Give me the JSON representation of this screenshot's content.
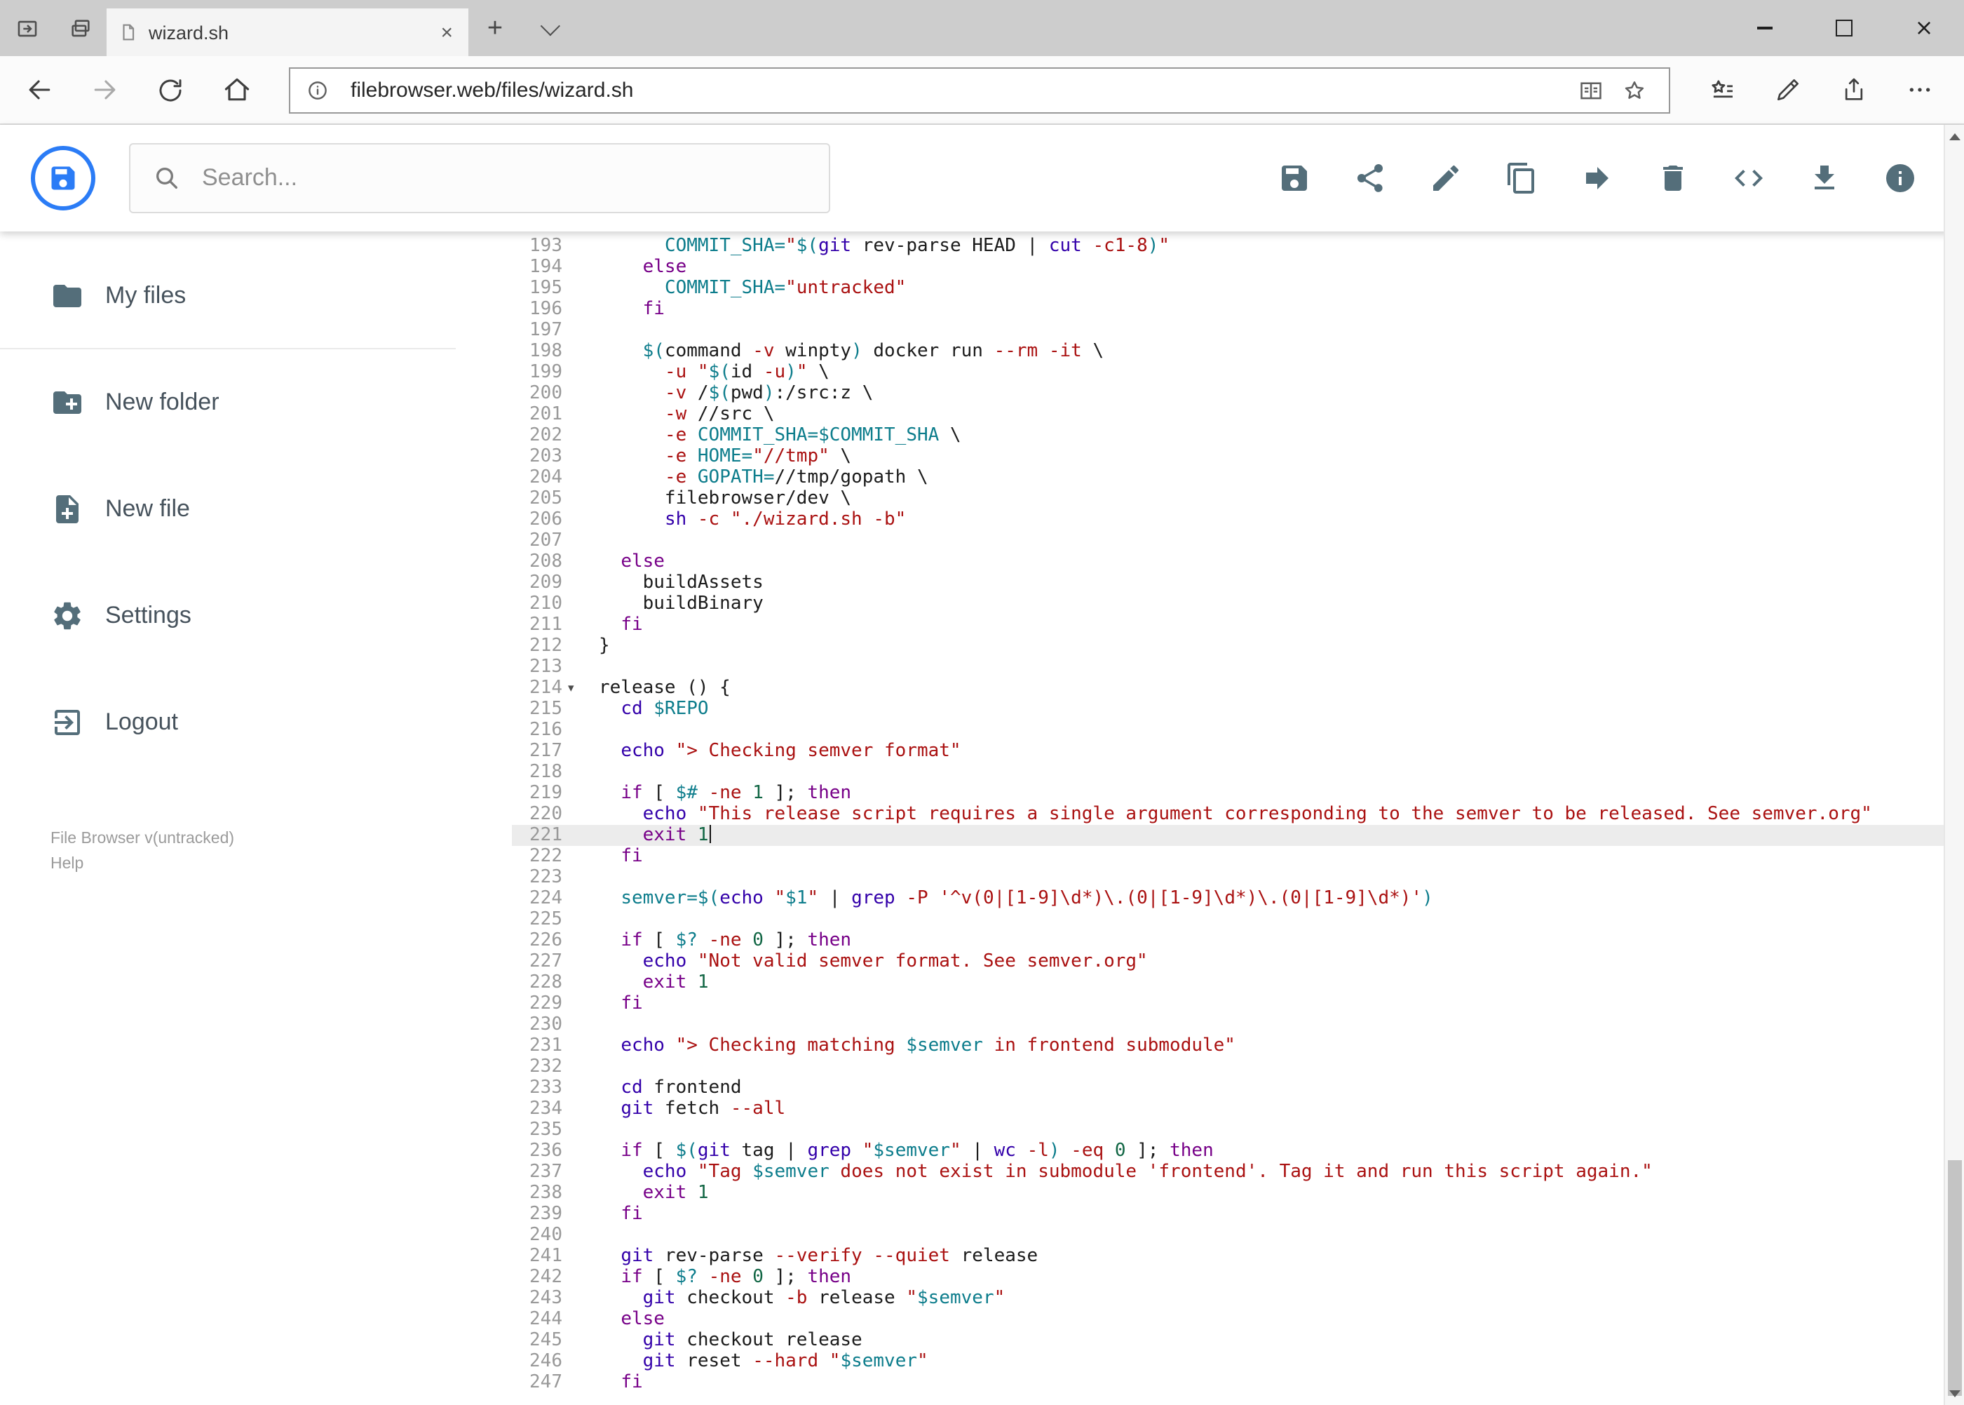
{
  "window": {
    "tab_title": "wizard.sh"
  },
  "browser": {
    "tab": {
      "title": "wizard.sh"
    },
    "url": "filebrowser.web/files/wizard.sh",
    "nav_icons": [
      "back",
      "forward",
      "refresh",
      "home"
    ],
    "url_icons": [
      "page-info",
      "reading-view",
      "favorite-star"
    ],
    "right_icons": [
      "hub-favorites",
      "web-note",
      "share",
      "more"
    ],
    "window_controls": [
      "minimize",
      "maximize",
      "close"
    ],
    "strip_icons": [
      "tabs-set-aside",
      "tab-preview"
    ]
  },
  "app_header": {
    "search_placeholder": "Search...",
    "toolbar_icons": [
      "save",
      "share",
      "edit",
      "copy",
      "move",
      "delete",
      "code",
      "download",
      "info"
    ],
    "colors": {
      "accent_blue": "#2b7cf6",
      "icon_gray": "#546e7a"
    }
  },
  "sidebar": {
    "items": [
      {
        "icon": "folder-icon",
        "label": "My files"
      },
      {
        "icon": "new-folder-icon",
        "label": "New folder"
      },
      {
        "icon": "new-file-icon",
        "label": "New file"
      },
      {
        "icon": "settings-icon",
        "label": "Settings"
      },
      {
        "icon": "logout-icon",
        "label": "Logout"
      }
    ],
    "footer": {
      "version": "File Browser v(untracked)",
      "help": "Help"
    }
  },
  "editor": {
    "active_line": 221,
    "fold_line": 214,
    "token_colors": {
      "p": "#1b1b1b",
      "k": "#770088",
      "b": "#3300aa",
      "s": "#aa1111",
      "v": "#0d7d8c",
      "num": "#116644"
    },
    "lines": [
      {
        "n": 193,
        "t": [
          [
            "p",
            "      "
          ],
          [
            "v",
            "COMMIT_SHA="
          ],
          [
            "s",
            "\""
          ],
          [
            "v",
            "$("
          ],
          [
            "b",
            "git"
          ],
          [
            "p",
            " rev-parse HEAD | "
          ],
          [
            "b",
            "cut"
          ],
          [
            "p",
            " "
          ],
          [
            "s",
            "-c1-8"
          ],
          [
            "v",
            ")"
          ],
          [
            "s",
            "\""
          ]
        ]
      },
      {
        "n": 194,
        "t": [
          [
            "p",
            "    "
          ],
          [
            "k",
            "else"
          ]
        ]
      },
      {
        "n": 195,
        "t": [
          [
            "p",
            "      "
          ],
          [
            "v",
            "COMMIT_SHA="
          ],
          [
            "s",
            "\"untracked\""
          ]
        ]
      },
      {
        "n": 196,
        "t": [
          [
            "p",
            "    "
          ],
          [
            "k",
            "fi"
          ]
        ]
      },
      {
        "n": 197,
        "t": []
      },
      {
        "n": 198,
        "t": [
          [
            "p",
            "    "
          ],
          [
            "v",
            "$("
          ],
          [
            "p",
            "command "
          ],
          [
            "s",
            "-v"
          ],
          [
            "p",
            " winpty"
          ],
          [
            "v",
            ")"
          ],
          [
            "p",
            " docker run "
          ],
          [
            "s",
            "--rm"
          ],
          [
            "p",
            " "
          ],
          [
            "s",
            "-it"
          ],
          [
            "p",
            " \\"
          ]
        ]
      },
      {
        "n": 199,
        "t": [
          [
            "p",
            "      "
          ],
          [
            "s",
            "-u"
          ],
          [
            "p",
            " "
          ],
          [
            "s",
            "\""
          ],
          [
            "v",
            "$("
          ],
          [
            "p",
            "id "
          ],
          [
            "s",
            "-u"
          ],
          [
            "v",
            ")"
          ],
          [
            "s",
            "\""
          ],
          [
            "p",
            " \\"
          ]
        ]
      },
      {
        "n": 200,
        "t": [
          [
            "p",
            "      "
          ],
          [
            "s",
            "-v"
          ],
          [
            "p",
            " /"
          ],
          [
            "v",
            "$("
          ],
          [
            "p",
            "pwd"
          ],
          [
            "v",
            ")"
          ],
          [
            "p",
            ":/src:z \\"
          ]
        ]
      },
      {
        "n": 201,
        "t": [
          [
            "p",
            "      "
          ],
          [
            "s",
            "-w"
          ],
          [
            "p",
            " //src \\"
          ]
        ]
      },
      {
        "n": 202,
        "t": [
          [
            "p",
            "      "
          ],
          [
            "s",
            "-e"
          ],
          [
            "p",
            " "
          ],
          [
            "v",
            "COMMIT_SHA=$COMMIT_SHA"
          ],
          [
            "p",
            " \\"
          ]
        ]
      },
      {
        "n": 203,
        "t": [
          [
            "p",
            "      "
          ],
          [
            "s",
            "-e"
          ],
          [
            "p",
            " "
          ],
          [
            "v",
            "HOME="
          ],
          [
            "s",
            "\"//tmp\""
          ],
          [
            "p",
            " \\"
          ]
        ]
      },
      {
        "n": 204,
        "t": [
          [
            "p",
            "      "
          ],
          [
            "s",
            "-e"
          ],
          [
            "p",
            " "
          ],
          [
            "v",
            "GOPATH="
          ],
          [
            "p",
            "//tmp/gopath \\"
          ]
        ]
      },
      {
        "n": 205,
        "t": [
          [
            "p",
            "      filebrowser/dev \\"
          ]
        ]
      },
      {
        "n": 206,
        "t": [
          [
            "p",
            "      "
          ],
          [
            "b",
            "sh"
          ],
          [
            "p",
            " "
          ],
          [
            "s",
            "-c"
          ],
          [
            "p",
            " "
          ],
          [
            "s",
            "\"./wizard.sh -b\""
          ]
        ]
      },
      {
        "n": 207,
        "t": []
      },
      {
        "n": 208,
        "t": [
          [
            "p",
            "  "
          ],
          [
            "k",
            "else"
          ]
        ]
      },
      {
        "n": 209,
        "t": [
          [
            "p",
            "    buildAssets"
          ]
        ]
      },
      {
        "n": 210,
        "t": [
          [
            "p",
            "    buildBinary"
          ]
        ]
      },
      {
        "n": 211,
        "t": [
          [
            "p",
            "  "
          ],
          [
            "k",
            "fi"
          ]
        ]
      },
      {
        "n": 212,
        "t": [
          [
            "p",
            "}"
          ]
        ]
      },
      {
        "n": 213,
        "t": []
      },
      {
        "n": 214,
        "t": [
          [
            "p",
            "release () {"
          ]
        ]
      },
      {
        "n": 215,
        "t": [
          [
            "p",
            "  "
          ],
          [
            "b",
            "cd"
          ],
          [
            "p",
            " "
          ],
          [
            "v",
            "$REPO"
          ]
        ]
      },
      {
        "n": 216,
        "t": []
      },
      {
        "n": 217,
        "t": [
          [
            "p",
            "  "
          ],
          [
            "b",
            "echo"
          ],
          [
            "p",
            " "
          ],
          [
            "s",
            "\"> Checking semver format\""
          ]
        ]
      },
      {
        "n": 218,
        "t": []
      },
      {
        "n": 219,
        "t": [
          [
            "p",
            "  "
          ],
          [
            "k",
            "if"
          ],
          [
            "p",
            " [ "
          ],
          [
            "v",
            "$#"
          ],
          [
            "p",
            " "
          ],
          [
            "s",
            "-ne"
          ],
          [
            "p",
            " "
          ],
          [
            "num",
            "1"
          ],
          [
            "p",
            " ]; "
          ],
          [
            "k",
            "then"
          ]
        ]
      },
      {
        "n": 220,
        "t": [
          [
            "p",
            "    "
          ],
          [
            "b",
            "echo"
          ],
          [
            "p",
            " "
          ],
          [
            "s",
            "\"This release script requires a single argument corresponding to the semver to be released. See semver.org\""
          ]
        ]
      },
      {
        "n": 221,
        "caret": true,
        "t": [
          [
            "p",
            "    "
          ],
          [
            "k",
            "exit"
          ],
          [
            "p",
            " "
          ],
          [
            "num",
            "1"
          ]
        ]
      },
      {
        "n": 222,
        "t": [
          [
            "p",
            "  "
          ],
          [
            "k",
            "fi"
          ]
        ]
      },
      {
        "n": 223,
        "t": []
      },
      {
        "n": 224,
        "t": [
          [
            "p",
            "  "
          ],
          [
            "v",
            "semver=$("
          ],
          [
            "b",
            "echo"
          ],
          [
            "p",
            " "
          ],
          [
            "s",
            "\""
          ],
          [
            "v",
            "$1"
          ],
          [
            "s",
            "\""
          ],
          [
            "p",
            " | "
          ],
          [
            "b",
            "grep"
          ],
          [
            "p",
            " "
          ],
          [
            "s",
            "-P"
          ],
          [
            "p",
            " "
          ],
          [
            "s",
            "'^v(0|[1-9]\\d*)\\.(0|[1-9]\\d*)\\.(0|[1-9]\\d*)'"
          ],
          [
            "v",
            ")"
          ]
        ]
      },
      {
        "n": 225,
        "t": []
      },
      {
        "n": 226,
        "t": [
          [
            "p",
            "  "
          ],
          [
            "k",
            "if"
          ],
          [
            "p",
            " [ "
          ],
          [
            "v",
            "$?"
          ],
          [
            "p",
            " "
          ],
          [
            "s",
            "-ne"
          ],
          [
            "p",
            " "
          ],
          [
            "num",
            "0"
          ],
          [
            "p",
            " ]; "
          ],
          [
            "k",
            "then"
          ]
        ]
      },
      {
        "n": 227,
        "t": [
          [
            "p",
            "    "
          ],
          [
            "b",
            "echo"
          ],
          [
            "p",
            " "
          ],
          [
            "s",
            "\"Not valid semver format. See semver.org\""
          ]
        ]
      },
      {
        "n": 228,
        "t": [
          [
            "p",
            "    "
          ],
          [
            "k",
            "exit"
          ],
          [
            "p",
            " "
          ],
          [
            "num",
            "1"
          ]
        ]
      },
      {
        "n": 229,
        "t": [
          [
            "p",
            "  "
          ],
          [
            "k",
            "fi"
          ]
        ]
      },
      {
        "n": 230,
        "t": []
      },
      {
        "n": 231,
        "t": [
          [
            "p",
            "  "
          ],
          [
            "b",
            "echo"
          ],
          [
            "p",
            " "
          ],
          [
            "s",
            "\"> Checking matching "
          ],
          [
            "v",
            "$semver"
          ],
          [
            "s",
            " in frontend submodule\""
          ]
        ]
      },
      {
        "n": 232,
        "t": []
      },
      {
        "n": 233,
        "t": [
          [
            "p",
            "  "
          ],
          [
            "b",
            "cd"
          ],
          [
            "p",
            " frontend"
          ]
        ]
      },
      {
        "n": 234,
        "t": [
          [
            "p",
            "  "
          ],
          [
            "b",
            "git"
          ],
          [
            "p",
            " fetch "
          ],
          [
            "s",
            "--all"
          ]
        ]
      },
      {
        "n": 235,
        "t": []
      },
      {
        "n": 236,
        "t": [
          [
            "p",
            "  "
          ],
          [
            "k",
            "if"
          ],
          [
            "p",
            " [ "
          ],
          [
            "v",
            "$("
          ],
          [
            "b",
            "git"
          ],
          [
            "p",
            " tag | "
          ],
          [
            "b",
            "grep"
          ],
          [
            "p",
            " "
          ],
          [
            "s",
            "\""
          ],
          [
            "v",
            "$semver"
          ],
          [
            "s",
            "\""
          ],
          [
            "p",
            " | "
          ],
          [
            "b",
            "wc"
          ],
          [
            "p",
            " "
          ],
          [
            "s",
            "-l"
          ],
          [
            "v",
            ")"
          ],
          [
            "p",
            " "
          ],
          [
            "s",
            "-eq"
          ],
          [
            "p",
            " "
          ],
          [
            "num",
            "0"
          ],
          [
            "p",
            " ]; "
          ],
          [
            "k",
            "then"
          ]
        ]
      },
      {
        "n": 237,
        "t": [
          [
            "p",
            "    "
          ],
          [
            "b",
            "echo"
          ],
          [
            "p",
            " "
          ],
          [
            "s",
            "\"Tag "
          ],
          [
            "v",
            "$semver"
          ],
          [
            "s",
            " does not exist in submodule 'frontend'. Tag it and run this script again.\""
          ]
        ]
      },
      {
        "n": 238,
        "t": [
          [
            "p",
            "    "
          ],
          [
            "k",
            "exit"
          ],
          [
            "p",
            " "
          ],
          [
            "num",
            "1"
          ]
        ]
      },
      {
        "n": 239,
        "t": [
          [
            "p",
            "  "
          ],
          [
            "k",
            "fi"
          ]
        ]
      },
      {
        "n": 240,
        "t": []
      },
      {
        "n": 241,
        "t": [
          [
            "p",
            "  "
          ],
          [
            "b",
            "git"
          ],
          [
            "p",
            " rev-parse "
          ],
          [
            "s",
            "--verify"
          ],
          [
            "p",
            " "
          ],
          [
            "s",
            "--quiet"
          ],
          [
            "p",
            " release"
          ]
        ]
      },
      {
        "n": 242,
        "t": [
          [
            "p",
            "  "
          ],
          [
            "k",
            "if"
          ],
          [
            "p",
            " [ "
          ],
          [
            "v",
            "$?"
          ],
          [
            "p",
            " "
          ],
          [
            "s",
            "-ne"
          ],
          [
            "p",
            " "
          ],
          [
            "num",
            "0"
          ],
          [
            "p",
            " ]; "
          ],
          [
            "k",
            "then"
          ]
        ]
      },
      {
        "n": 243,
        "t": [
          [
            "p",
            "    "
          ],
          [
            "b",
            "git"
          ],
          [
            "p",
            " checkout "
          ],
          [
            "s",
            "-b"
          ],
          [
            "p",
            " release "
          ],
          [
            "s",
            "\""
          ],
          [
            "v",
            "$semver"
          ],
          [
            "s",
            "\""
          ]
        ]
      },
      {
        "n": 244,
        "t": [
          [
            "p",
            "  "
          ],
          [
            "k",
            "else"
          ]
        ]
      },
      {
        "n": 245,
        "t": [
          [
            "p",
            "    "
          ],
          [
            "b",
            "git"
          ],
          [
            "p",
            " checkout release"
          ]
        ]
      },
      {
        "n": 246,
        "t": [
          [
            "p",
            "    "
          ],
          [
            "b",
            "git"
          ],
          [
            "p",
            " reset "
          ],
          [
            "s",
            "--hard"
          ],
          [
            "p",
            " "
          ],
          [
            "s",
            "\""
          ],
          [
            "v",
            "$semver"
          ],
          [
            "s",
            "\""
          ]
        ]
      },
      {
        "n": 247,
        "t": [
          [
            "p",
            "  "
          ],
          [
            "k",
            "fi"
          ]
        ]
      }
    ]
  }
}
